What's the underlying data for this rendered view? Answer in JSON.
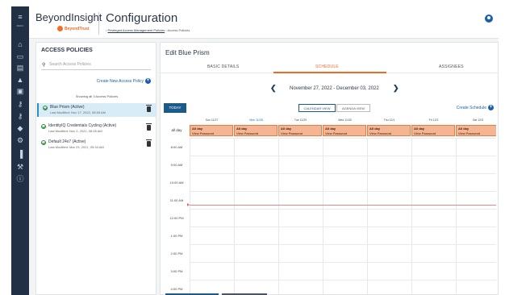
{
  "app": {
    "brand": "BeyondInsight",
    "logo_text": "BeyondTrust",
    "page_title": "Configuration",
    "breadcrumb": [
      "Privileged Access Management Policies",
      "Access Policies"
    ]
  },
  "rail": {
    "menu_label": "MENU",
    "icons": [
      "menu-icon",
      "home-icon",
      "monitor-icon",
      "document-icon",
      "warning-icon",
      "briefcase-icon",
      "key-icon",
      "key-alt-icon",
      "shield-icon",
      "gear-icon",
      "chart-icon",
      "wrench-icon",
      "info-icon"
    ]
  },
  "left_panel": {
    "title": "ACCESS POLICIES",
    "search_placeholder": "Search Access Policies",
    "create_label": "Create New Access Policy",
    "showing": "Showing all 3 Access Policies",
    "policies": [
      {
        "name": "Blue Prism (Active)",
        "modified": "Last Modified: Nov 17, 2022, 08:55 AM",
        "selected": true
      },
      {
        "name": "IdentityIQ Credentials Cycling (Active)",
        "modified": "Last Modified: Nov 2, 2022, 08:45 AM",
        "selected": false
      },
      {
        "name": "Default 24x7 (Active)",
        "modified": "Last Modified: Mar 23, 2021, 05:34 AM",
        "selected": false
      }
    ]
  },
  "right_panel": {
    "title": "Edit Blue Prism",
    "tabs": [
      "BASIC DETAILS",
      "SCHEDULE",
      "ASSIGNEES"
    ],
    "active_tab": "SCHEDULE",
    "range": "November 27, 2022 - December 03, 2022",
    "today_label": "TODAY",
    "calendar_view_label": "CALENDAR VIEW",
    "agenda_view_label": "AGENDA VIEW",
    "create_schedule_label": "Create Schedule",
    "days": [
      "Sun 11/27",
      "Mon 11/28",
      "Tue 11/29",
      "Wed 11/30",
      "Thu 12/1",
      "Fri 12/2",
      "Sat 12/3"
    ],
    "highlight_day": "Mon 11/28",
    "all_day_label": "all day",
    "event_title": "All day",
    "event_subtitle": "View Password",
    "times": [
      "8:00 AM",
      "9:00 AM",
      "10:00 AM",
      "11:00 AM",
      "12:00 PM",
      "1:00 PM",
      "2:00 PM",
      "3:00 PM",
      "4:00 PM"
    ]
  },
  "colors": {
    "rail": "#223046",
    "accent": "#f06a23",
    "event_fill": "#f6b592",
    "primary_button": "#1a5b8a"
  }
}
